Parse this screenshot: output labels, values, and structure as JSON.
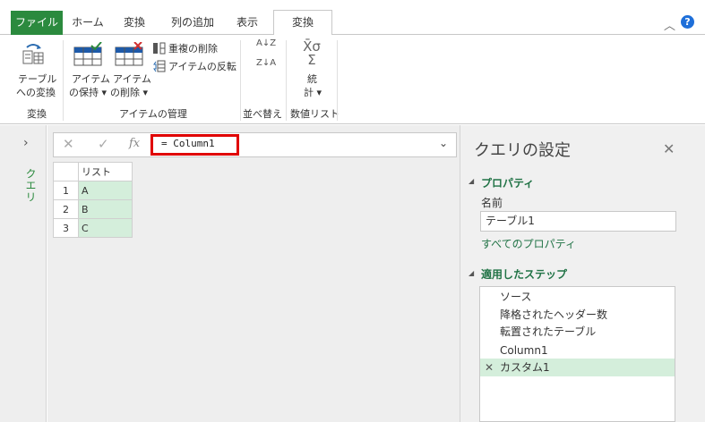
{
  "tabs": {
    "file": "ファイル",
    "home": "ホーム",
    "transform1": "変換",
    "add_column": "列の追加",
    "view": "表示",
    "transform2": "変換"
  },
  "ribbon": {
    "to_table_line1": "テーブル",
    "to_table_line2": "への変換",
    "keep_items_line1": "アイテム",
    "keep_items_line2": "の保持 ▾",
    "remove_items_line1": "アイテム",
    "remove_items_line2": "の削除 ▾",
    "remove_duplicates": "重複の削除",
    "reverse_items": "アイテムの反転",
    "sort_az": "A↓Z",
    "sort_za": "Z↓A",
    "stats_line1": "統",
    "stats_line2": "計 ▾",
    "stats_symbol1": "X̄σ",
    "stats_symbol2": "Σ",
    "group_convert": "変換",
    "group_manage": "アイテムの管理",
    "group_sort": "並べ替え",
    "group_numeric": "数値リスト"
  },
  "left_pane": {
    "label": "クエリ"
  },
  "formula": {
    "fx": "fx",
    "text": "= Column1"
  },
  "grid": {
    "header": "リスト",
    "rows": [
      {
        "num": "1",
        "val": "A"
      },
      {
        "num": "2",
        "val": "B"
      },
      {
        "num": "3",
        "val": "C"
      }
    ]
  },
  "settings": {
    "title": "クエリの設定",
    "properties_heading": "プロパティ",
    "name_label": "名前",
    "name_value": "テーブル1",
    "all_properties": "すべてのプロパティ",
    "steps_heading": "適用したステップ",
    "steps": [
      "ソース",
      "降格されたヘッダー数",
      "転置されたテーブル",
      "Column1",
      "カスタム1"
    ]
  },
  "colors": {
    "accent_green": "#2b8a3e",
    "link_green": "#217346",
    "selection": "#d4eedb",
    "highlight_red": "#e00000"
  }
}
